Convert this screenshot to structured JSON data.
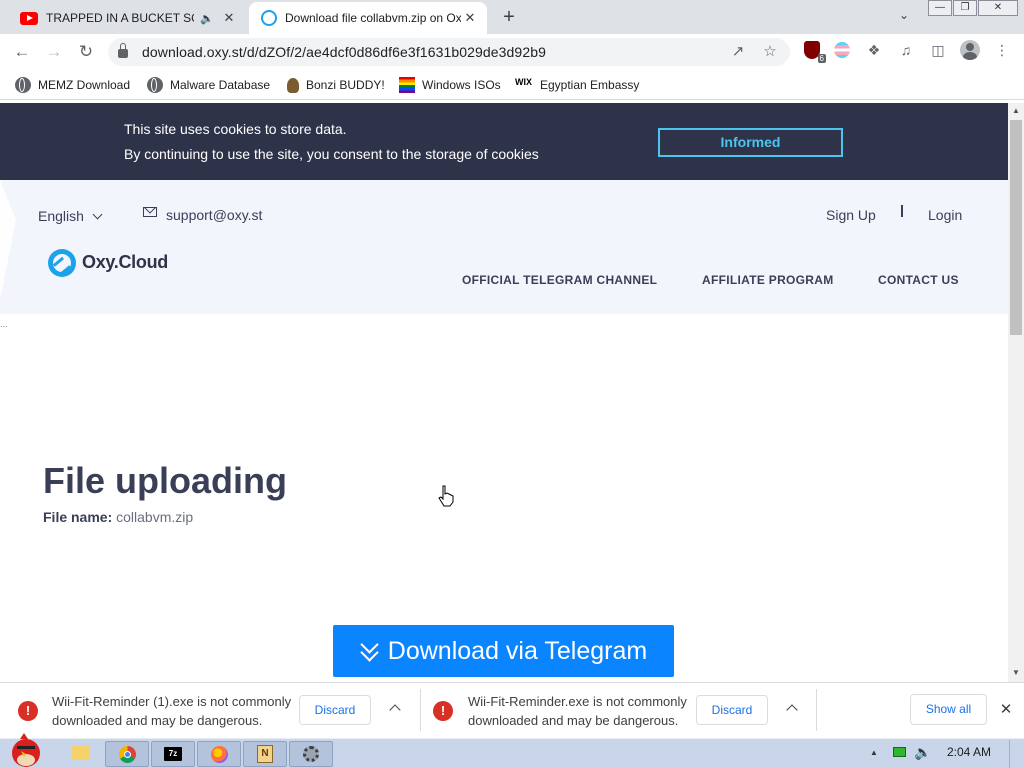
{
  "browser": {
    "tabs": [
      {
        "title": "TRAPPED IN A BUCKET SOCIAL",
        "icon": "youtube-icon",
        "audio": "speaker-icon",
        "active": false
      },
      {
        "title": "Download file collabvm.zip on Oxy.Cloud",
        "icon": "oxy-cloud-favicon",
        "active": true
      }
    ],
    "new_tab_label": "+",
    "address": "download.oxy.st/d/dZOf/2/ae4dcf0d86df6e3f1631b029de3d92b9",
    "extension_badge": "6",
    "bookmarks": [
      {
        "label": "MEMZ Download",
        "icon": "globe-icon"
      },
      {
        "label": "Malware Database",
        "icon": "globe-icon"
      },
      {
        "label": "Bonzi BUDDY!",
        "icon": "bonzi-icon"
      },
      {
        "label": "Windows ISOs",
        "icon": "windows-logo-icon"
      },
      {
        "label": "Egyptian Embassy",
        "icon": "wix-icon"
      }
    ]
  },
  "cookie_banner": {
    "line1": "This site uses cookies to store data.",
    "line2": "By continuing to use the site, you consent to the storage of cookies",
    "button": "Informed"
  },
  "header": {
    "language": "English",
    "email": "support@oxy.st",
    "sign_up": "Sign Up",
    "separator": "I",
    "login": "Login",
    "logo": "Oxy.Cloud",
    "nav": [
      "OFFICIAL TELEGRAM CHANNEL",
      "AFFILIATE PROGRAM",
      "CONTACT US"
    ],
    "loader_dots": "..."
  },
  "main": {
    "heading": "File uploading",
    "file_label": "File name:",
    "file_name": "collabvm.zip",
    "download_button": "Download via Telegram"
  },
  "downloads": {
    "items": [
      {
        "line1": "Wii-Fit-Reminder (1).exe is not commonly",
        "line2": "downloaded and may be dangerous.",
        "discard": "Discard"
      },
      {
        "line1": "Wii-Fit-Reminder.exe is not commonly",
        "line2": "downloaded and may be dangerous.",
        "discard": "Discard"
      }
    ],
    "show_all": "Show all"
  },
  "taskbar": {
    "clock": "2:04 AM",
    "apps": [
      "folder-icon",
      "chrome-icon",
      "7zip-icon",
      "firefox-icon",
      "notepad-icon",
      "settings-gear-icon"
    ],
    "sevenz_label": "7z",
    "notepad_label": "N"
  },
  "colors": {
    "cookie_bg": "#2f3349",
    "accent": "#4cc4f0",
    "download_button": "#0a84ff",
    "header_bg": "#f3f5fc",
    "warning": "#d93025"
  }
}
